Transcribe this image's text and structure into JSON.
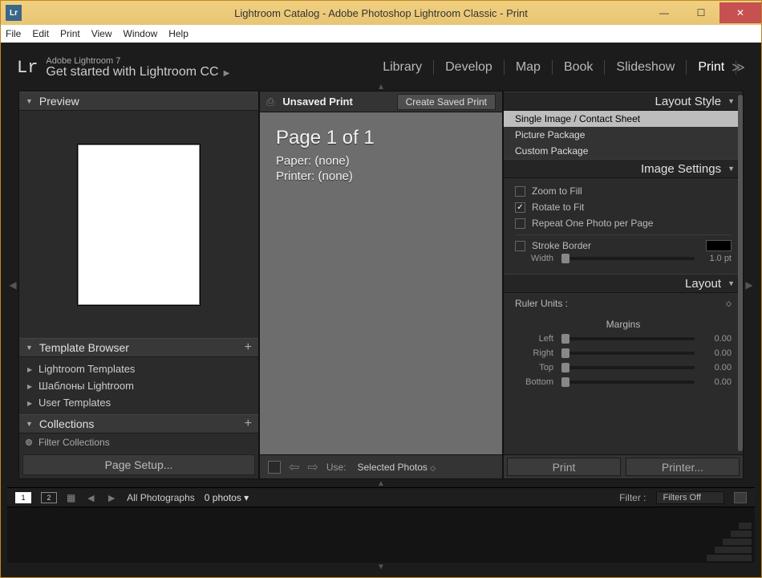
{
  "window": {
    "title": "Lightroom Catalog - Adobe Photoshop Lightroom Classic - Print"
  },
  "menubar": [
    "File",
    "Edit",
    "Print",
    "View",
    "Window",
    "Help"
  ],
  "identity": {
    "version": "Adobe Lightroom 7",
    "tagline": "Get started with Lightroom CC"
  },
  "modules": {
    "items": [
      "Library",
      "Develop",
      "Map",
      "Book",
      "Slideshow",
      "Print"
    ],
    "active": "Print"
  },
  "left": {
    "preview_title": "Preview",
    "template_title": "Template Browser",
    "templates": [
      "Lightroom Templates",
      "Шаблоны Lightroom",
      "User Templates"
    ],
    "collections_title": "Collections",
    "filter_placeholder": "Filter Collections",
    "page_setup": "Page Setup..."
  },
  "center": {
    "doc_title": "Unsaved Print",
    "save_btn": "Create Saved Print",
    "page_label": "Page 1 of 1",
    "paper": "Paper:  (none)",
    "printer": "Printer:  (none)",
    "use_label": "Use:",
    "use_value": "Selected Photos"
  },
  "right": {
    "layout_style_title": "Layout Style",
    "styles": [
      "Single Image / Contact Sheet",
      "Picture Package",
      "Custom Package"
    ],
    "image_settings_title": "Image Settings",
    "zoom_to_fill": "Zoom to Fill",
    "rotate_to_fit": "Rotate to Fit",
    "repeat_one": "Repeat One Photo per Page",
    "stroke_border": "Stroke Border",
    "width_label": "Width",
    "width_val": "1.0 pt",
    "layout_title": "Layout",
    "ruler_units": "Ruler Units :",
    "margins_title": "Margins",
    "margins": {
      "left": {
        "label": "Left",
        "val": "0.00"
      },
      "right": {
        "label": "Right",
        "val": "0.00"
      },
      "top": {
        "label": "Top",
        "val": "0.00"
      },
      "bottom": {
        "label": "Bottom",
        "val": "0.00"
      }
    },
    "print_btn": "Print",
    "printer_btn": "Printer..."
  },
  "filmstrip": {
    "counts": [
      "1",
      "2"
    ],
    "source": "All Photographs",
    "count": "0 photos",
    "filter_label": "Filter :",
    "filter_value": "Filters Off"
  }
}
